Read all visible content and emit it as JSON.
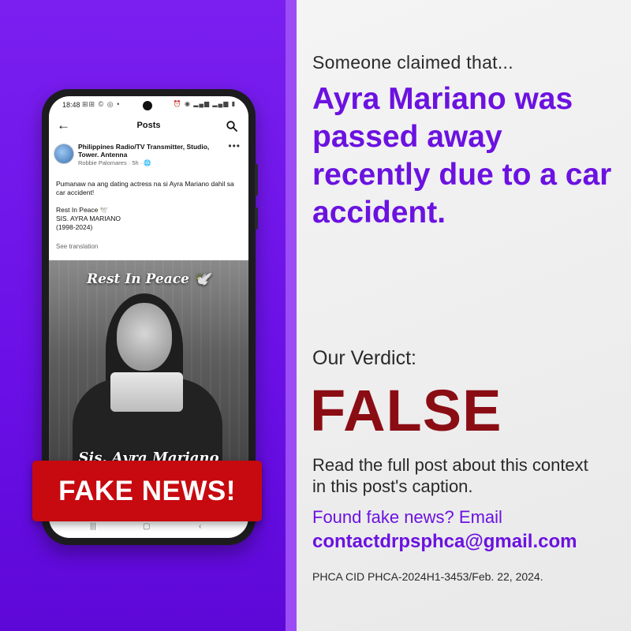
{
  "claim": {
    "intro": "Someone claimed that...",
    "text": "Ayra Mariano was passed away recently due to a car accident."
  },
  "verdict": {
    "label": "Our Verdict:",
    "value": "FALSE"
  },
  "footer": {
    "read_more": "Read the full post about this context in this post's caption.",
    "found_fake": "Found fake news? Email",
    "email": "contactdrpsphca@gmail.com",
    "cid": "PHCA CID PHCA-2024H1-3453/Feb. 22, 2024."
  },
  "phone": {
    "status_time": "18:48",
    "appbar_title": "Posts",
    "post": {
      "page_name": "Philippines Radio/TV Transmitter, Studio, Tower. Antenna",
      "author": "Robbie Palomares",
      "time": "5h",
      "text_line1": "Pumanaw na ang dating actress na si Ayra Mariano dahil sa car accident!",
      "text_line2": "Rest In Peace 🕊️",
      "text_line3": "SIS. AYRA MARIANO",
      "text_line4": "(1998-2024)",
      "see_translation": "See translation",
      "photo_caption_top": "Rest In Peace 🕊️",
      "photo_caption_bottom": "Sis. Ayra Mariano"
    },
    "icons": {
      "back": "back-arrow-icon",
      "search": "search-icon",
      "more": "more-icon",
      "globe": "globe-icon"
    }
  },
  "banner": {
    "text": "FAKE NEWS!"
  },
  "colors": {
    "purple": "#6b12e0",
    "verdict_red": "#8b0d14",
    "banner_red": "#c70a0f"
  }
}
